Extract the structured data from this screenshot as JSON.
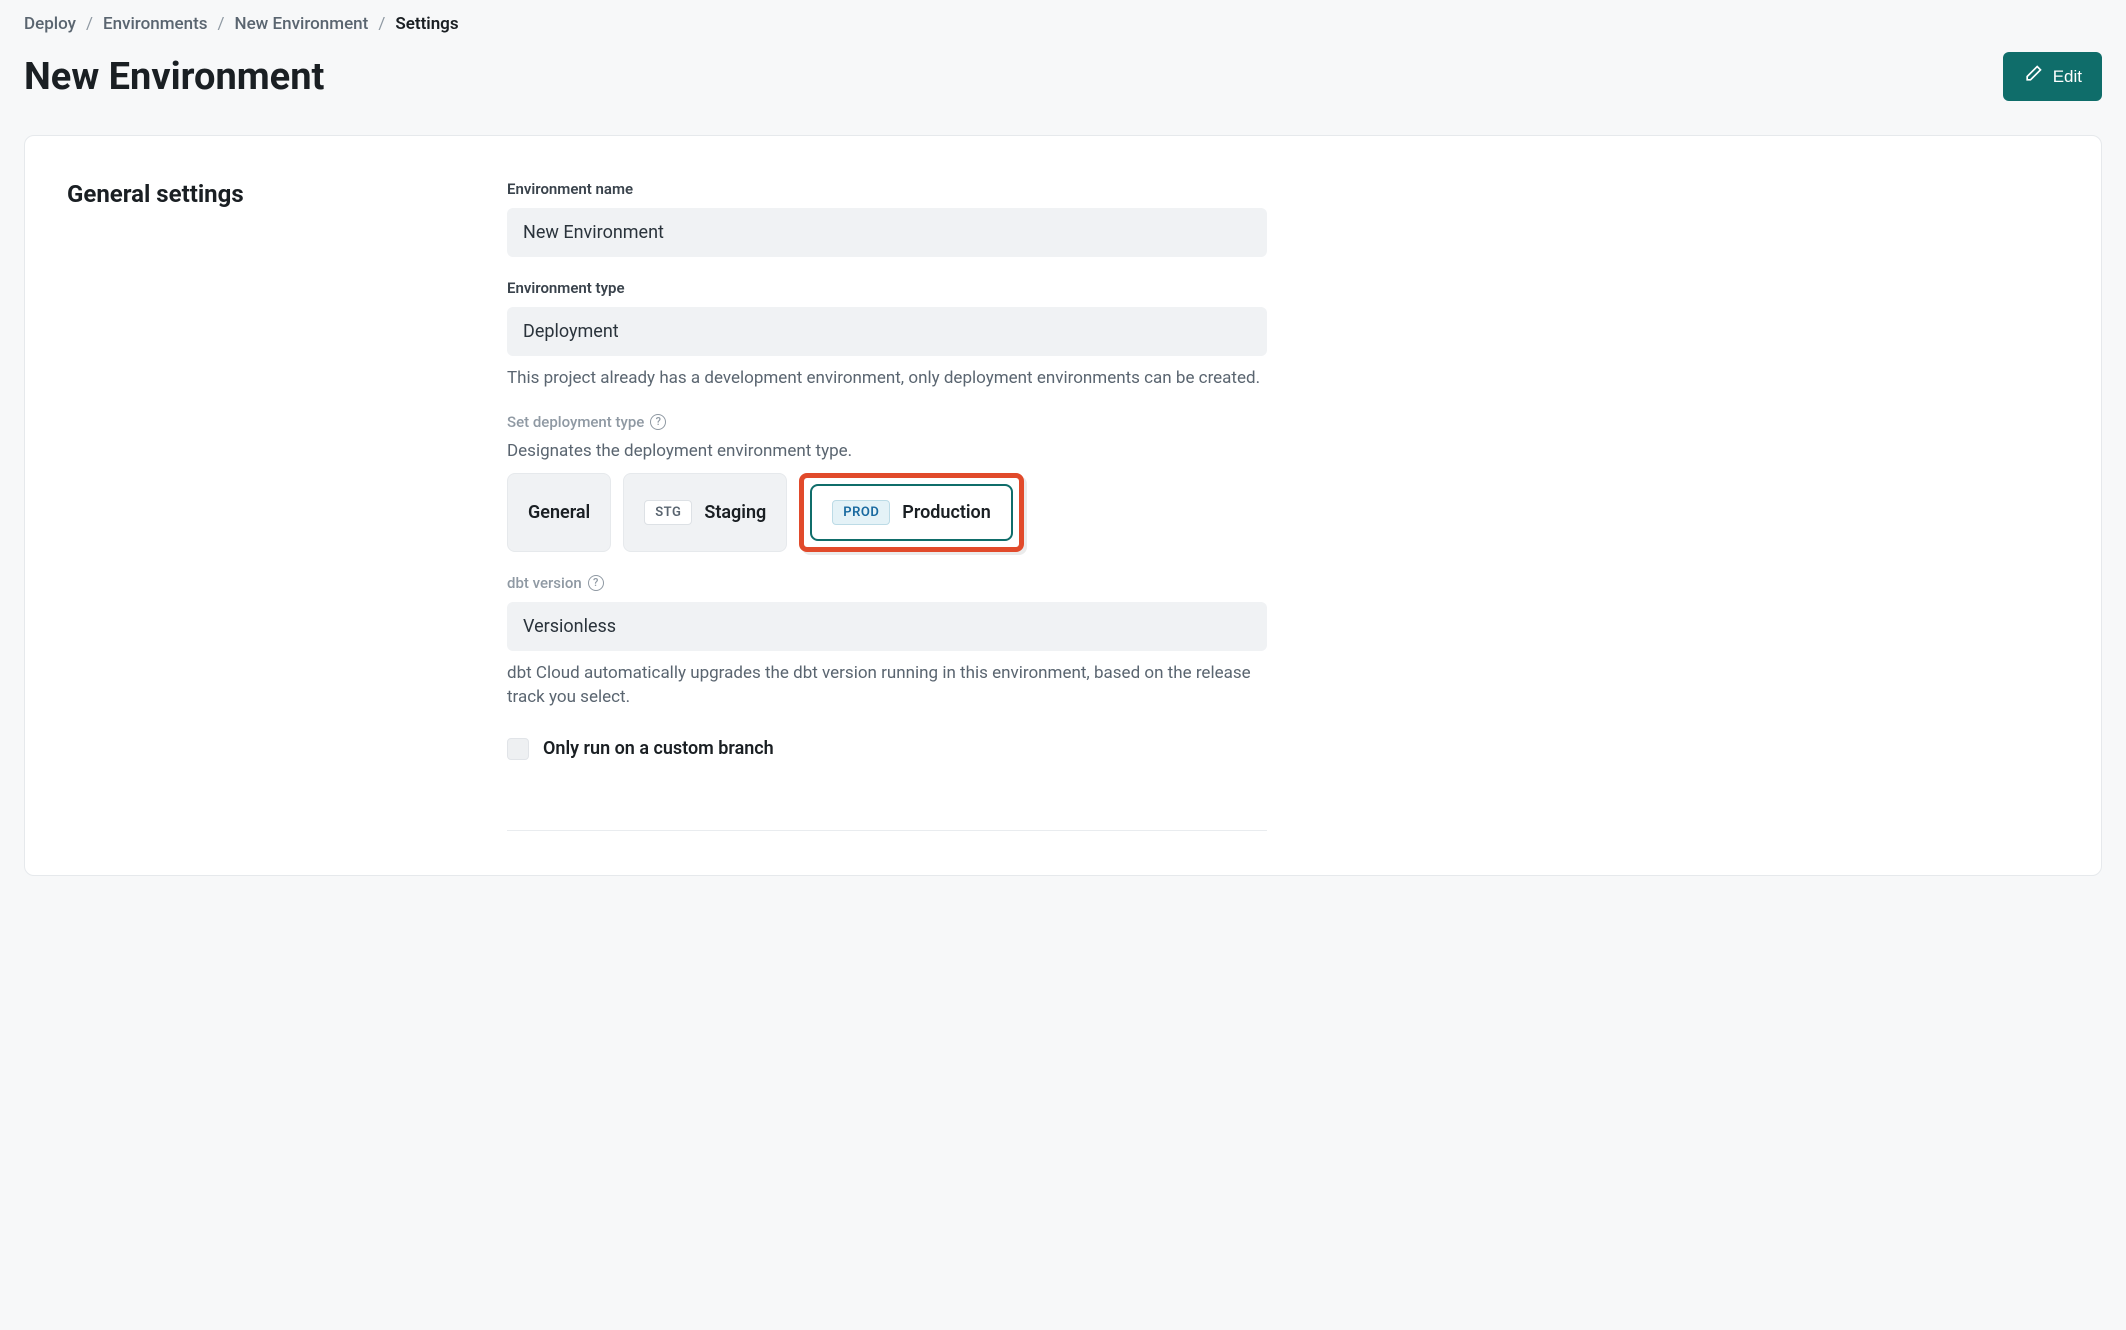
{
  "breadcrumb": {
    "items": [
      "Deploy",
      "Environments",
      "New Environment"
    ],
    "current": "Settings"
  },
  "header": {
    "title": "New Environment",
    "edit_label": "Edit"
  },
  "section": {
    "title": "General settings"
  },
  "fields": {
    "env_name": {
      "label": "Environment name",
      "value": "New Environment"
    },
    "env_type": {
      "label": "Environment type",
      "value": "Deployment",
      "help": "This project already has a development environment, only deployment environments can be created."
    },
    "deployment_type": {
      "label": "Set deployment type",
      "subtext": "Designates the deployment environment type.",
      "options": {
        "general": {
          "label": "General"
        },
        "staging": {
          "badge": "STG",
          "label": "Staging"
        },
        "production": {
          "badge": "PROD",
          "label": "Production"
        }
      }
    },
    "dbt_version": {
      "label": "dbt version",
      "value": "Versionless",
      "help": "dbt Cloud automatically upgrades the dbt version running in this environment, based on the release track you select."
    },
    "custom_branch": {
      "label": "Only run on a custom branch"
    }
  }
}
